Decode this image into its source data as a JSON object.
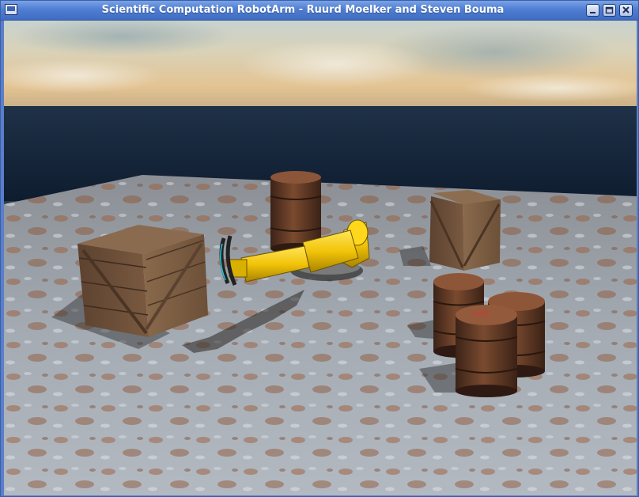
{
  "window": {
    "title": "Scientific Computation RobotArm - Ruurd Moelker and Steven Bouma",
    "icon": "window-app-icon",
    "controls": [
      "minimize-icon",
      "maximize-icon",
      "close-icon"
    ]
  },
  "scene": {
    "description_objects": [
      "skybox",
      "ocean",
      "rusty-metal-platform",
      "wooden-crate",
      "wooden-crate",
      "oil-barrel",
      "oil-barrel",
      "oil-barrel",
      "oil-barrel",
      "robot-arm"
    ],
    "colors": {
      "sky_top": "#c9d3cf",
      "sky_horizon": "#e2c79a",
      "ocean": "#15253a",
      "platform": "#9aa2a8",
      "rust": "#9a5a35",
      "crate": "#6b4c33",
      "barrel": "#5a3625",
      "robot": "#f2c40a"
    }
  }
}
